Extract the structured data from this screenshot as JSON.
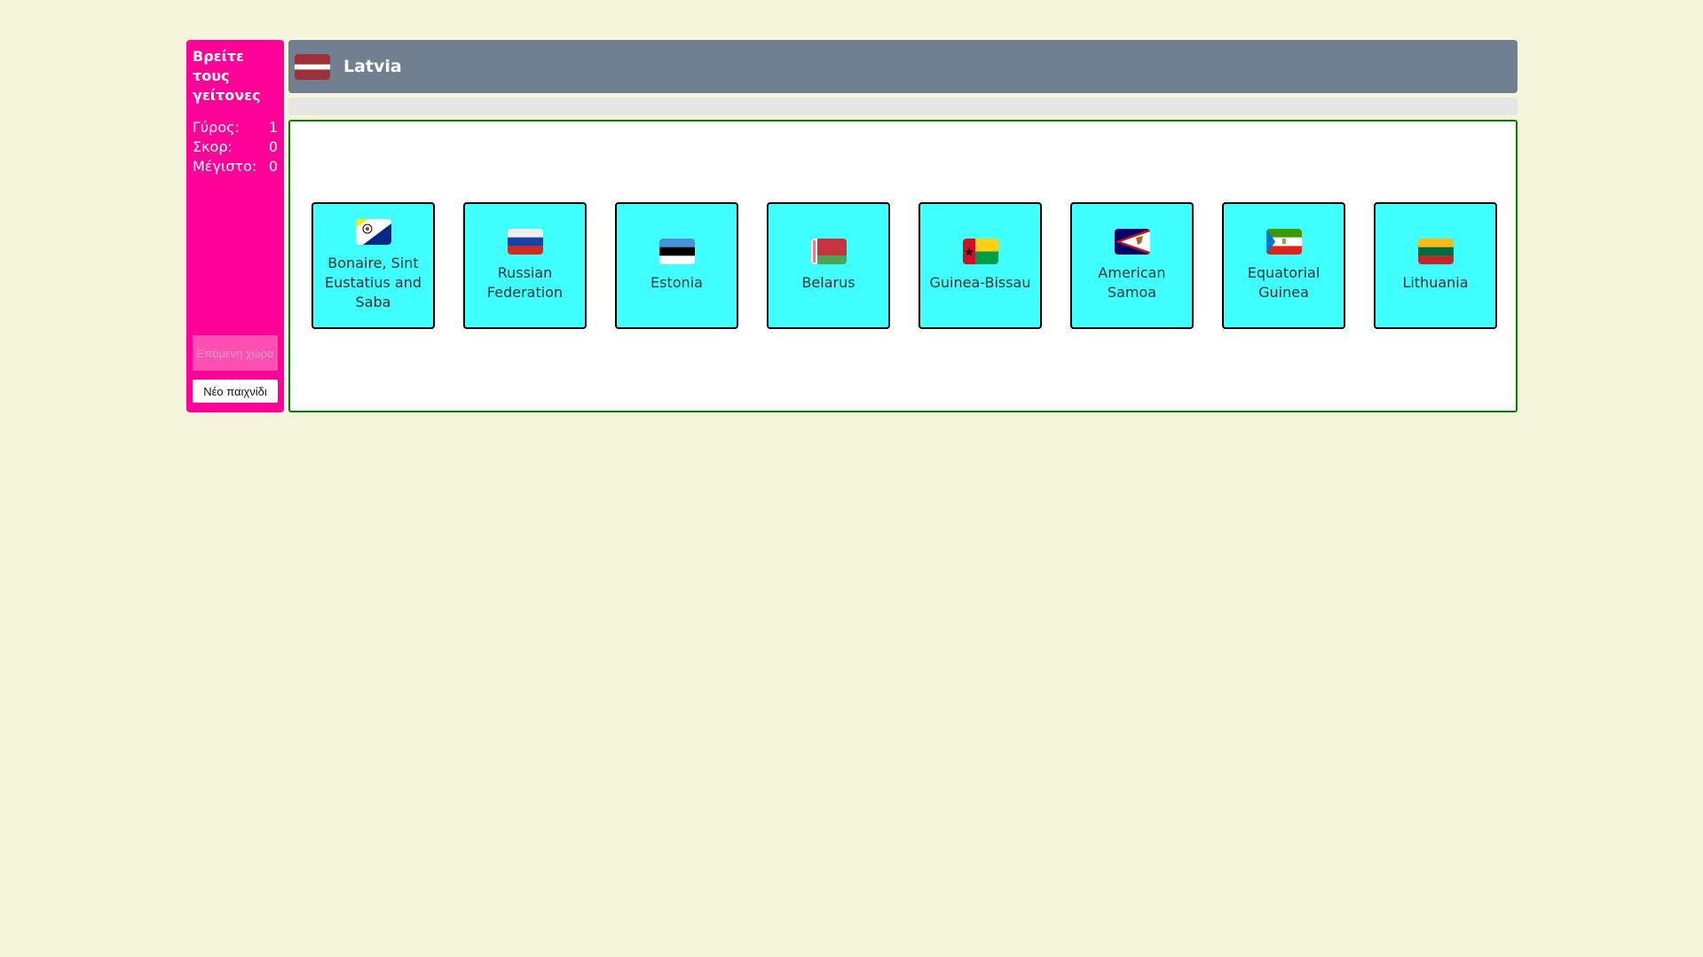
{
  "sidebar": {
    "title": "Βρείτε τους γείτονες",
    "stats": [
      {
        "label": "Γύρος:",
        "value": "1"
      },
      {
        "label": "Σκορ:",
        "value": "0"
      },
      {
        "label": "Μέγιστο:",
        "value": "0"
      }
    ],
    "next_label": "Επόμενη χώρα",
    "new_game_label": "Νέο παιχνίδι"
  },
  "header": {
    "country": "Latvia",
    "flag_icon": "latvia-flag-icon"
  },
  "colors": {
    "background": "#f5f5dc",
    "sidebar": "#ff0099",
    "header": "#708090",
    "card": "#40ffff",
    "board_border": "#008000"
  },
  "cards": [
    {
      "name": "Bonaire, Sint Eustatius and Saba",
      "icon": "bonaire-flag-icon"
    },
    {
      "name": "Russian Federation",
      "icon": "russia-flag-icon"
    },
    {
      "name": "Estonia",
      "icon": "estonia-flag-icon"
    },
    {
      "name": "Belarus",
      "icon": "belarus-flag-icon"
    },
    {
      "name": "Guinea-Bissau",
      "icon": "guinea-bissau-flag-icon"
    },
    {
      "name": "American Samoa",
      "icon": "american-samoa-flag-icon"
    },
    {
      "name": "Equatorial Guinea",
      "icon": "equatorial-guinea-flag-icon"
    },
    {
      "name": "Lithuania",
      "icon": "lithuania-flag-icon"
    }
  ]
}
